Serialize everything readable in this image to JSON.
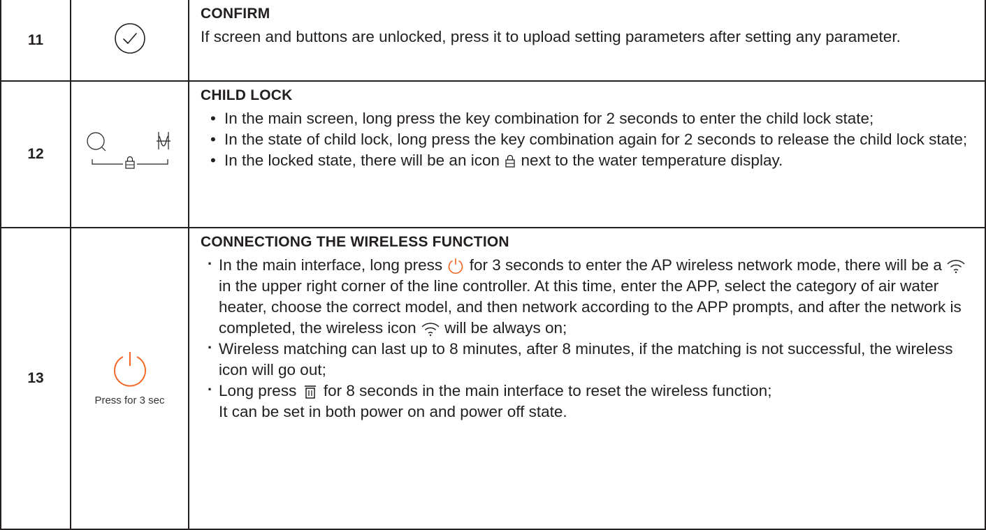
{
  "rows": [
    {
      "number": "11",
      "icon": "check-circle-icon",
      "title": "CONFIRM",
      "text": "If screen and buttons are unlocked, press it to upload setting parameters after setting any parameter."
    },
    {
      "number": "12",
      "icon": "child-lock-key-combination-icon",
      "title": "CHILD LOCK",
      "bullets": [
        "In the main screen, long press the key combination for 2 seconds to enter the child lock state;",
        "In the state of child lock, long press the key combination again for 2 seconds to release the child lock state;",
        {
          "before": "In the locked state, there will be an icon",
          "after": "next to the water temperature display."
        }
      ]
    },
    {
      "number": "13",
      "icon": "power-icon",
      "icon_label": "Press for 3 sec",
      "title": "CONNECTIONG THE WIRELESS FUNCTION",
      "items": [
        {
          "p1": "In the main interface, long press",
          "p2": "for 3 seconds to enter the AP wireless network mode, there will be a",
          "p3": "in the upper right corner of the line controller. At this time, enter the APP, select the category of air water heater, choose the correct model, and then network according to the APP prompts, and after the network is completed, the wireless icon",
          "p4": "will be always on;"
        },
        {
          "text": "Wireless matching can last up to 8 minutes, after 8 minutes, if the matching is not successful, the wireless icon will go out;"
        },
        {
          "p1": "Long press",
          "p2": "for 8 seconds in the main interface to reset the wireless function;",
          "line2": "It can be set in both power on and power off state."
        }
      ]
    }
  ],
  "colors": {
    "power_icon": "#f26522",
    "text": "#231f20",
    "border": "#231f20"
  }
}
